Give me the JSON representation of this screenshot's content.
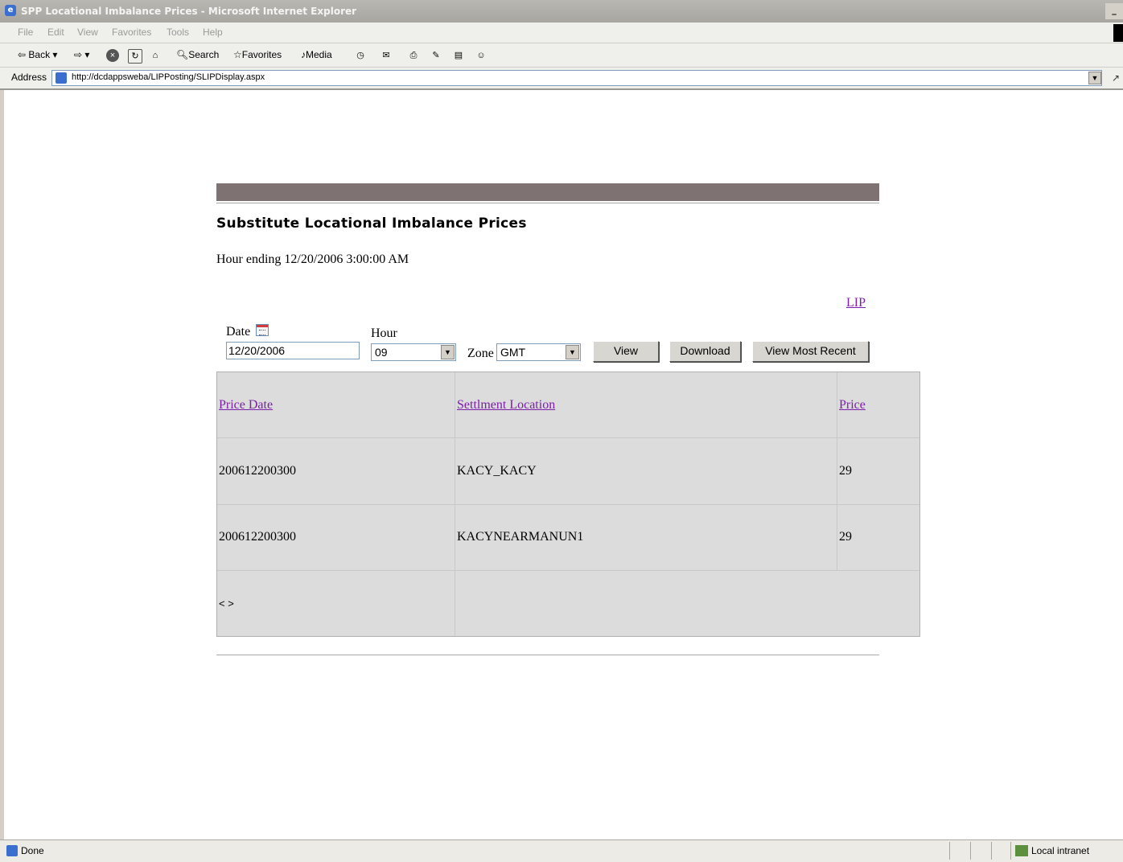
{
  "window": {
    "title": "SPP Locational Imbalance Prices - Microsoft Internet Explorer"
  },
  "menu": [
    "File",
    "Edit",
    "View",
    "Favorites",
    "Tools",
    "Help"
  ],
  "toolbar": {
    "back": "Back",
    "search": "Search",
    "favorites": "Favorites",
    "media": "Media"
  },
  "address": {
    "label": "Address",
    "url": "http://dcdappsweba/LIPPosting/SLIPDisplay.aspx"
  },
  "page": {
    "title": "Substitute Locational Imbalance Prices",
    "hour_ending": "Hour ending 12/20/2006 3:00:00 AM",
    "lip_link": "LIP"
  },
  "form": {
    "date_label": "Date",
    "date_value": "12/20/2006",
    "hour_label": "Hour",
    "hour_value": "09",
    "zone_label": "Zone",
    "zone_value": "GMT",
    "view_button": "View",
    "download_button": "Download",
    "most_recent_button": "View Most Recent"
  },
  "table": {
    "headers": [
      "Price Date",
      "Settlment Location",
      "Price"
    ],
    "rows": [
      [
        "200612200300",
        "KACY_KACY",
        "29"
      ],
      [
        "200612200300",
        "KACYNEARMANUN1",
        "29"
      ]
    ],
    "pager": "< >"
  },
  "status": {
    "text": "Done",
    "zone": "Local intranet"
  },
  "colors": {
    "banner": "#7e7272",
    "link": "#7a1fa8",
    "grid_bg": "#dcdcdc"
  }
}
